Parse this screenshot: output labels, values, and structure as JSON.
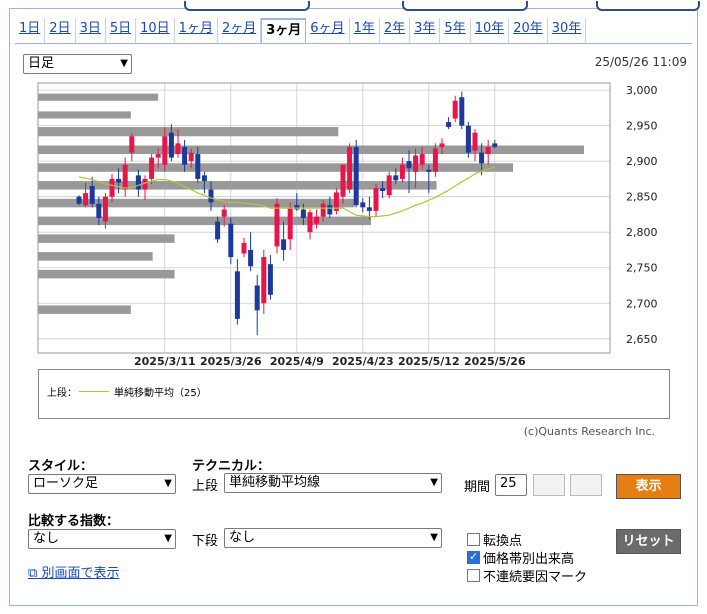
{
  "tabs": [
    "1日",
    "2日",
    "3日",
    "5日",
    "10日",
    "1ヶ月",
    "2ヶ月",
    "3ヶ月",
    "6ヶ月",
    "1年",
    "2年",
    "3年",
    "5年",
    "10年",
    "20年",
    "30年"
  ],
  "active_tab": "3ヶ月",
  "interval_select": "日足",
  "datetime": "25/05/26 11:09",
  "legend": {
    "section": "上段：",
    "series_name": "単純移動平均（25）"
  },
  "credit": "(c)Quants Research Inc.",
  "controls": {
    "style_label": "スタイル：",
    "style_value": "ローソク足",
    "technical_label": "テクニカル：",
    "upper_label": "上段",
    "upper_value": "単純移動平均線",
    "period_label": "期間",
    "period_value": "25",
    "show_button": "表示",
    "compare_label": "比較する指数：",
    "compare_value": "なし",
    "lower_label": "下段",
    "lower_value": "なし",
    "reset_button": "リセット",
    "popup_link": "別画面で表示",
    "checkboxes": [
      {
        "label": "転換点",
        "checked": false
      },
      {
        "label": "価格帯別出来高",
        "checked": true
      },
      {
        "label": "不連続要因マーク",
        "checked": false
      }
    ]
  },
  "colors": {
    "up": "#e8144a",
    "down": "#1c3a9c",
    "ma": "#b5c43b",
    "volume_profile": "#999999",
    "show_button": "#e67e14",
    "reset_button": "#6b6b6b"
  },
  "chart_data": {
    "type": "candlestick",
    "y_range": [
      2630,
      3010
    ],
    "y_ticks": [
      3000,
      2950,
      2900,
      2850,
      2800,
      2750,
      2700,
      2650
    ],
    "y_tick_labels": [
      "3,000",
      "2,950",
      "2,900",
      "2,850",
      "2,800",
      "2,750",
      "2,700",
      "2,650"
    ],
    "x_tick_labels": [
      {
        "index": 13,
        "label": "2025/3/11"
      },
      {
        "index": 23,
        "label": "2025/3/26"
      },
      {
        "index": 33,
        "label": "2025/4/9"
      },
      {
        "index": 43,
        "label": "2025/4/23"
      },
      {
        "index": 53,
        "label": "2025/5/12"
      },
      {
        "index": 63,
        "label": "2025/5/26"
      }
    ],
    "grid": true,
    "candles": [
      [
        2850,
        2852,
        2838,
        2840
      ],
      [
        2838,
        2870,
        2835,
        2855
      ],
      [
        2865,
        2878,
        2835,
        2840
      ],
      [
        2840,
        2850,
        2810,
        2820
      ],
      [
        2815,
        2855,
        2805,
        2850
      ],
      [
        2850,
        2882,
        2842,
        2875
      ],
      [
        2875,
        2890,
        2855,
        2870
      ],
      [
        2860,
        2905,
        2850,
        2895
      ],
      [
        2912,
        2940,
        2900,
        2935
      ],
      [
        2880,
        2888,
        2850,
        2860
      ],
      [
        2860,
        2880,
        2845,
        2875
      ],
      [
        2875,
        2910,
        2868,
        2905
      ],
      [
        2905,
        2918,
        2890,
        2910
      ],
      [
        2895,
        2948,
        2885,
        2935
      ],
      [
        2940,
        2952,
        2900,
        2905
      ],
      [
        2910,
        2945,
        2905,
        2925
      ],
      [
        2920,
        2930,
        2885,
        2895
      ],
      [
        2900,
        2918,
        2890,
        2912
      ],
      [
        2910,
        2920,
        2870,
        2875
      ],
      [
        2880,
        2885,
        2855,
        2872
      ],
      [
        2860,
        2872,
        2830,
        2842
      ],
      [
        2815,
        2822,
        2785,
        2790
      ],
      [
        2822,
        2838,
        2808,
        2832
      ],
      [
        2812,
        2820,
        2755,
        2765
      ],
      [
        2745,
        2762,
        2670,
        2678
      ],
      [
        2770,
        2792,
        2765,
        2785
      ],
      [
        2775,
        2800,
        2745,
        2752
      ],
      [
        2725,
        2740,
        2655,
        2690
      ],
      [
        2700,
        2775,
        2685,
        2765
      ],
      [
        2755,
        2768,
        2705,
        2712
      ],
      [
        2780,
        2848,
        2770,
        2840
      ],
      [
        2790,
        2815,
        2760,
        2775
      ],
      [
        2790,
        2842,
        2775,
        2835
      ],
      [
        2838,
        2855,
        2830,
        2832
      ],
      [
        2832,
        2840,
        2810,
        2820
      ],
      [
        2800,
        2832,
        2790,
        2828
      ],
      [
        2812,
        2832,
        2805,
        2822
      ],
      [
        2822,
        2845,
        2815,
        2840
      ],
      [
        2838,
        2850,
        2820,
        2825
      ],
      [
        2830,
        2862,
        2825,
        2856
      ],
      [
        2850,
        2895,
        2840,
        2895
      ],
      [
        2860,
        2925,
        2855,
        2920
      ],
      [
        2920,
        2930,
        2835,
        2838
      ],
      [
        2842,
        2848,
        2828,
        2835
      ],
      [
        2835,
        2850,
        2818,
        2830
      ],
      [
        2830,
        2868,
        2822,
        2862
      ],
      [
        2862,
        2872,
        2848,
        2858
      ],
      [
        2852,
        2885,
        2848,
        2880
      ],
      [
        2880,
        2890,
        2868,
        2873
      ],
      [
        2875,
        2905,
        2870,
        2895
      ],
      [
        2900,
        2915,
        2855,
        2890
      ],
      [
        2885,
        2918,
        2862,
        2908
      ],
      [
        2895,
        2920,
        2888,
        2910
      ],
      [
        2888,
        2895,
        2855,
        2885
      ],
      [
        2885,
        2925,
        2878,
        2918
      ],
      [
        2920,
        2932,
        2910,
        2925
      ],
      [
        2955,
        2962,
        2945,
        2948
      ],
      [
        2960,
        2992,
        2955,
        2985
      ],
      [
        2990,
        2998,
        2945,
        2950
      ],
      [
        2950,
        2955,
        2905,
        2912
      ],
      [
        2915,
        2945,
        2900,
        2940
      ],
      [
        2912,
        2925,
        2880,
        2897
      ],
      [
        2910,
        2930,
        2895,
        2920
      ],
      [
        2925,
        2930,
        2918,
        2920
      ]
    ],
    "moving_average_25": [
      2878,
      2876,
      2874,
      2871,
      2868,
      2866,
      2864,
      2862,
      2863,
      2866,
      2869,
      2872,
      2874,
      2874,
      2872,
      2869,
      2864,
      2860,
      2855,
      2852,
      2848,
      2846,
      2843,
      2842,
      2842,
      2841,
      2840,
      2839,
      2837,
      2834,
      2834,
      2834,
      2834,
      2834,
      2834,
      2834,
      2834,
      2834,
      2834,
      2834,
      2834,
      2829,
      2824,
      2823,
      2822,
      2822,
      2823,
      2824,
      2827,
      2830,
      2834,
      2838,
      2841,
      2845,
      2849,
      2854,
      2859,
      2865,
      2871,
      2876,
      2882,
      2886,
      2889,
      2892
    ],
    "volume_profile_levels": [
      [
        2985,
        2995,
        0.22
      ],
      [
        2960,
        2970,
        0.17
      ],
      [
        2935,
        2948,
        0.55
      ],
      [
        2910,
        2922,
        1.0
      ],
      [
        2885,
        2897,
        0.87
      ],
      [
        2860,
        2872,
        0.73
      ],
      [
        2835,
        2847,
        0.58
      ],
      [
        2810,
        2822,
        0.61
      ],
      [
        2785,
        2797,
        0.25
      ],
      [
        2760,
        2772,
        0.21
      ],
      [
        2735,
        2747,
        0.25
      ],
      [
        2685,
        2697,
        0.17
      ]
    ]
  }
}
